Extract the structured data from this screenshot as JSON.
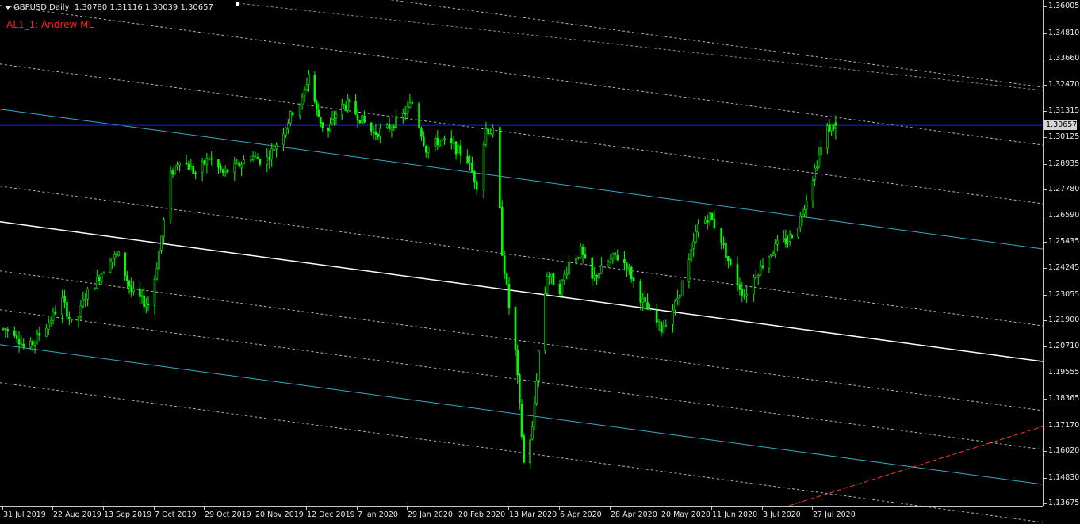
{
  "header": {
    "symbol_timeframe": "GBPUSD,Daily",
    "ohlc": "1.30780 1.31116 1.30039 1.30657"
  },
  "indicator": {
    "label": "AL1_1: Andrew ML"
  },
  "colors": {
    "background": "#000000",
    "candle": "#00ff00",
    "channel_line": "#3aa9c6",
    "median_line": "#ffffff",
    "dashed_line": "#b4b4b4",
    "price_line": "#1a1aff",
    "red_line": "#ff3b20",
    "axis_text": "#e8e8e8"
  },
  "yaxis": {
    "labels": [
      "1.36005",
      "1.34810",
      "1.33660",
      "1.32470",
      "1.31315",
      "1.30125",
      "1.28935",
      "1.27780",
      "1.26590",
      "1.25435",
      "1.24245",
      "1.23055",
      "1.21900",
      "1.20710",
      "1.19555",
      "1.18365",
      "1.17170",
      "1.16020",
      "1.14830",
      "1.13675"
    ],
    "current_price": "1.30657"
  },
  "xaxis": {
    "labels": [
      "31 Jul 2019",
      "22 Aug 2019",
      "13 Sep 2019",
      "7 Oct 2019",
      "29 Oct 2019",
      "20 Nov 2019",
      "12 Dec 2019",
      "7 Jan 2020",
      "29 Jan 2020",
      "20 Feb 2020",
      "13 Mar 2020",
      "6 Apr 2020",
      "28 Apr 2020",
      "20 May 2020",
      "11 Jun 2020",
      "3 Jul 2020",
      "27 Jul 2020"
    ]
  },
  "chart_data": {
    "type": "candlestick",
    "symbol": "GBPUSD",
    "timeframe": "Daily",
    "ylim": [
      1.135,
      1.361
    ],
    "x_range": [
      "31 Jul 2019",
      "07 Aug 2020"
    ],
    "series_path": [
      [
        "31 Jul 2019",
        1.215
      ],
      [
        "05 Aug 2019",
        1.214
      ],
      [
        "10 Aug 2019",
        1.205
      ],
      [
        "14 Aug 2019",
        1.21
      ],
      [
        "20 Aug 2019",
        1.218
      ],
      [
        "26 Aug 2019",
        1.228
      ],
      [
        "31 Aug 2019",
        1.215
      ],
      [
        "05 Sep 2019",
        1.23
      ],
      [
        "10 Sep 2019",
        1.237
      ],
      [
        "16 Sep 2019",
        1.247
      ],
      [
        "20 Sep 2019",
        1.248
      ],
      [
        "26 Sep 2019",
        1.232
      ],
      [
        "02 Oct 2019",
        1.227
      ],
      [
        "05 Oct 2019",
        1.226
      ],
      [
        "09 Oct 2019",
        1.25
      ],
      [
        "14 Oct 2019",
        1.284
      ],
      [
        "18 Oct 2019",
        1.292
      ],
      [
        "25 Oct 2019",
        1.285
      ],
      [
        "31 Oct 2019",
        1.292
      ],
      [
        "06 Nov 2019",
        1.285
      ],
      [
        "12 Nov 2019",
        1.288
      ],
      [
        "18 Nov 2019",
        1.293
      ],
      [
        "24 Nov 2019",
        1.29
      ],
      [
        "30 Nov 2019",
        1.3
      ],
      [
        "06 Dec 2019",
        1.313
      ],
      [
        "10 Dec 2019",
        1.318
      ],
      [
        "13 Dec 2019",
        1.33
      ],
      [
        "17 Dec 2019",
        1.313
      ],
      [
        "22 Dec 2019",
        1.302
      ],
      [
        "28 Dec 2019",
        1.314
      ],
      [
        "02 Jan 2020",
        1.316
      ],
      [
        "08 Jan 2020",
        1.31
      ],
      [
        "14 Jan 2020",
        1.303
      ],
      [
        "20 Jan 2020",
        1.305
      ],
      [
        "27 Jan 2020",
        1.311
      ],
      [
        "31 Jan 2020",
        1.317
      ],
      [
        "06 Feb 2020",
        1.296
      ],
      [
        "12 Feb 2020",
        1.3
      ],
      [
        "18 Feb 2020",
        1.297
      ],
      [
        "24 Feb 2020",
        1.291
      ],
      [
        "28 Feb 2020",
        1.28
      ],
      [
        "03 Mar 2020",
        1.305
      ],
      [
        "07 Mar 2020",
        1.303
      ],
      [
        "10 Mar 2020",
        1.25
      ],
      [
        "13 Mar 2020",
        1.225
      ],
      [
        "16 Mar 2020",
        1.205
      ],
      [
        "20 Mar 2020",
        1.155
      ],
      [
        "24 Mar 2020",
        1.17
      ],
      [
        "27 Mar 2020",
        1.205
      ],
      [
        "31 Mar 2020",
        1.24
      ],
      [
        "06 Apr 2020",
        1.233
      ],
      [
        "10 Apr 2020",
        1.245
      ],
      [
        "15 Apr 2020",
        1.25
      ],
      [
        "20 Apr 2020",
        1.237
      ],
      [
        "25 Apr 2020",
        1.243
      ],
      [
        "30 Apr 2020",
        1.248
      ],
      [
        "05 May 2020",
        1.244
      ],
      [
        "10 May 2020",
        1.231
      ],
      [
        "15 May 2020",
        1.222
      ],
      [
        "20 May 2020",
        1.215
      ],
      [
        "26 May 2020",
        1.226
      ],
      [
        "01 Jun 2020",
        1.245
      ],
      [
        "05 Jun 2020",
        1.262
      ],
      [
        "10 Jun 2020",
        1.266
      ],
      [
        "15 Jun 2020",
        1.255
      ],
      [
        "20 Jun 2020",
        1.24
      ],
      [
        "25 Jun 2020",
        1.23
      ],
      [
        "30 Jun 2020",
        1.24
      ],
      [
        "05 Jul 2020",
        1.247
      ],
      [
        "10 Jul 2020",
        1.253
      ],
      [
        "15 Jul 2020",
        1.255
      ],
      [
        "20 Jul 2020",
        1.262
      ],
      [
        "24 Jul 2020",
        1.274
      ],
      [
        "29 Jul 2020",
        1.29
      ],
      [
        "03 Aug 2020",
        1.305
      ],
      [
        "07 Aug 2020",
        1.3066
      ]
    ],
    "last_ohlc": {
      "open": 1.3078,
      "high": 1.31116,
      "low": 1.30039,
      "close": 1.30657
    }
  }
}
